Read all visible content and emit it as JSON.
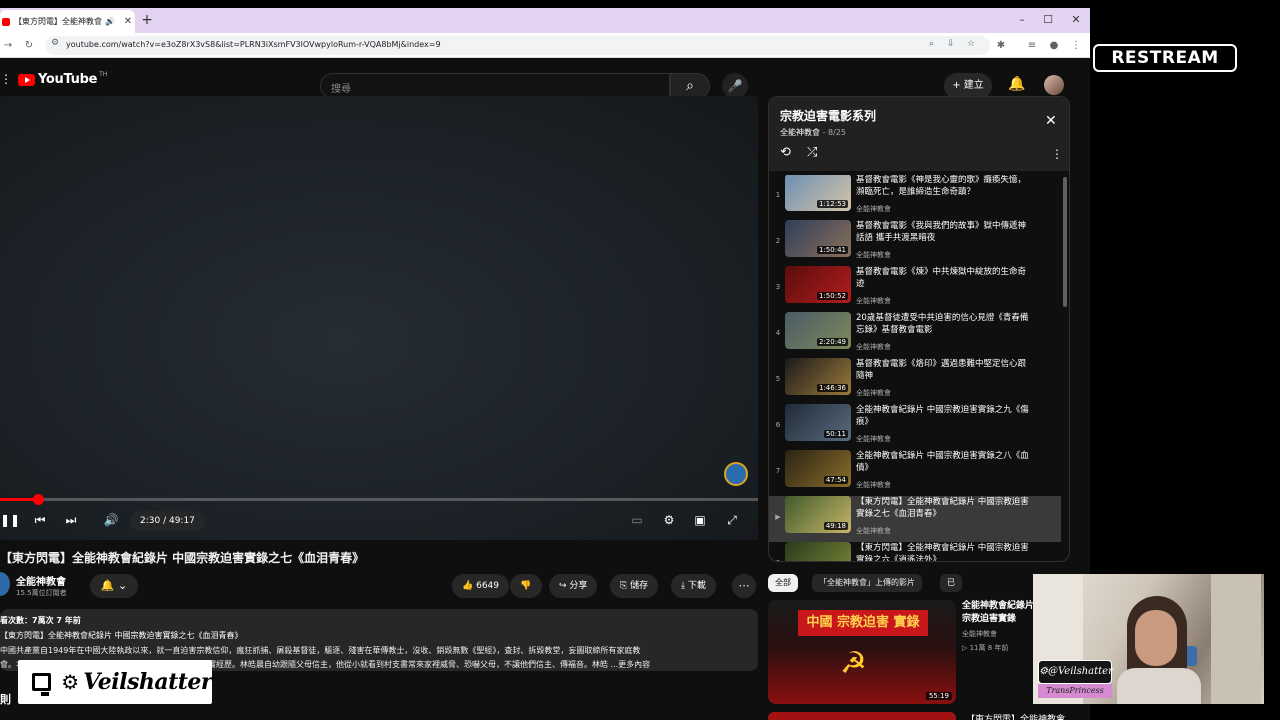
{
  "browser": {
    "tab_title": "【東方閃電】全能神教會紀",
    "url": "youtube.com/watch?v=e3oZ8rX3vS8&list=PLRN3iXsmFV3lOVwpyloRum-r-VQA8bMj&index=9"
  },
  "youtube": {
    "logo_text": "YouTube",
    "logo_country": "TH",
    "search_placeholder": "搜尋",
    "create_label": "建立"
  },
  "player": {
    "time": "2:30 / 49:17",
    "progress_fraction": 0.0507
  },
  "video": {
    "title": "【東方閃電】全能神教會紀錄片 中國宗教迫害實錄之七《血泪青春》",
    "channel": "全能神教會",
    "subscribers": "15.5萬位訂閱者",
    "likes": "6649",
    "share_label": "分享",
    "save_label": "儲存",
    "download_label": "下載",
    "desc_stats": "看次數：7萬次  7 年前",
    "desc_line1": "【東方閃電】全能神教會紀錄片 中國宗教迫害實錄之七《血泪青春》",
    "desc_line2": "中國共產黨自1949年在中國大陸執政以來，就一直迫害宗教信仰，瘋狂抓捕、屠殺基督徒，驅逐、殘害在華傳教士，沒收、銷毀無數《聖經》，査封、拆毀教堂，妄圖取締所有家庭教",
    "desc_line3": "會。本片講述了林晧晨在中國大陸信仰神期間遭受迫害的真實經歷。林皓晨自幼跟隨父母信主，他從小就看到村支書常來家裡威脅、恐嚇父母，不讓他們信主、傳福音。林皓 ...更多內容",
    "below_heading": "則"
  },
  "playlist": {
    "title": "宗教迫害電影系列",
    "channel": "全能神教會",
    "position": "8/25",
    "items": [
      {
        "index": "1",
        "title": "基督教會電影《神是我心靈的歌》癱瘓失憶，瀕臨死亡，是誰締造生命奇蹟？",
        "channel": "全能神教會",
        "duration": "1:12:53"
      },
      {
        "index": "2",
        "title": "基督教會電影《我與我們的故事》獄中傳遞神話語 攜手共渡黑暗夜",
        "channel": "全能神教會",
        "duration": "1:50:41"
      },
      {
        "index": "3",
        "title": "基督教會電影《煉》中共煉獄中綻放的生命奇迹",
        "channel": "全能神教會",
        "duration": "1:50:52"
      },
      {
        "index": "4",
        "title": "20歲基督徒遭受中共迫害的信心見證《青春備忘錄》基督教會電影",
        "channel": "全能神教會",
        "duration": "2:20:49"
      },
      {
        "index": "5",
        "title": "基督教會電影《烙印》邁過患難中堅定信心跟隨神",
        "channel": "全能神教會",
        "duration": "1:46:36"
      },
      {
        "index": "6",
        "title": "全能神教會紀錄片 中國宗教迫害實錄之九《傷痕》",
        "channel": "全能神教會",
        "duration": "50:11"
      },
      {
        "index": "7",
        "title": "全能神教會紀錄片 中國宗教迫害實錄之八《血債》",
        "channel": "全能神教會",
        "duration": "47:54"
      },
      {
        "index": "▶",
        "title": "【東方閃電】全能神教會紀錄片 中國宗教迫害實錄之七《血泪青春》",
        "channel": "全能神教會",
        "duration": "49:18"
      },
      {
        "index": "9",
        "title": "【東方閃電】全能神教會紀錄片 中國宗教迫害實錄之六《逍遙法外》",
        "channel": "全能神教會",
        "duration": ""
      }
    ]
  },
  "chips": [
    "全部",
    "「全能神教會」上傳的影片",
    "已"
  ],
  "recommendation": {
    "thumb_text": "中國 宗教迫害 實錄",
    "title": "全能神教會紀錄片 宗教迫害實錄",
    "channel": "全能神教會",
    "meta": "▷ 11萬  8 年前",
    "duration": "55:19",
    "next_title": "【東方閃電】全能神教會"
  },
  "overlays": {
    "restream": "RESTREAM",
    "webcam_tag": "@Veilshatter",
    "webcam_sub": "TransPrincess",
    "brand": "Veilshatter"
  }
}
